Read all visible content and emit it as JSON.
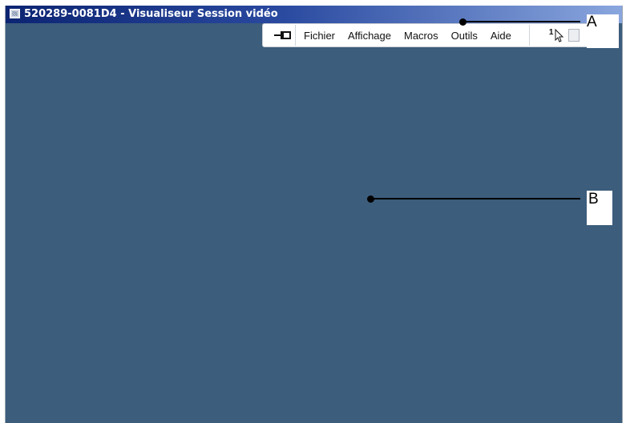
{
  "window": {
    "title": "520289-0081D4 - Visualiseur Session vidéo",
    "background_color": "#3c5d7c"
  },
  "menubar": {
    "pin_icon": "pushpin-icon",
    "items": [
      "Fichier",
      "Affichage",
      "Macros",
      "Outils",
      "Aide"
    ],
    "pointer_tool_number": "1",
    "pointer_tool_icon": "cursor-arrow-icon"
  },
  "callouts": [
    {
      "label": "A",
      "target": "menubar"
    },
    {
      "label": "B",
      "target": "session-video-area"
    }
  ]
}
